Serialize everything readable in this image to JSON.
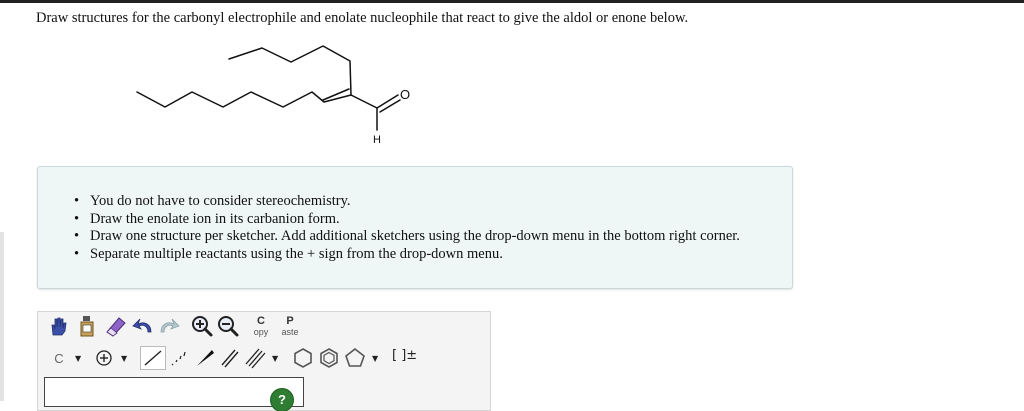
{
  "question": {
    "text": "Draw structures for the carbonyl electrophile and enolate nucleophile that react to give the aldol or enone below."
  },
  "molecule": {
    "atom_labels": {
      "oxygen": "O",
      "hydrogen": "H"
    }
  },
  "instructions": [
    "You do not have to consider stereochemistry.",
    "Draw the enolate ion in its carbanion form.",
    "Draw one structure per sketcher. Add additional sketchers using the drop-down menu in the bottom right corner.",
    "Separate multiple reactants using the + sign from the drop-down menu."
  ],
  "bullet_char": "•",
  "sketcher": {
    "toolbar_row1": {
      "copy_big": "C",
      "copy_small": "opy",
      "paste_big": "P",
      "paste_small": "aste"
    },
    "toolbar_row2": {
      "element": "C",
      "bracket": "[ ]±"
    },
    "help_label": "?"
  },
  "colors": {
    "info_box_bg": "#eef6f6",
    "help_green": "#2e7d32",
    "ring_gray": "#6b6b6b"
  }
}
